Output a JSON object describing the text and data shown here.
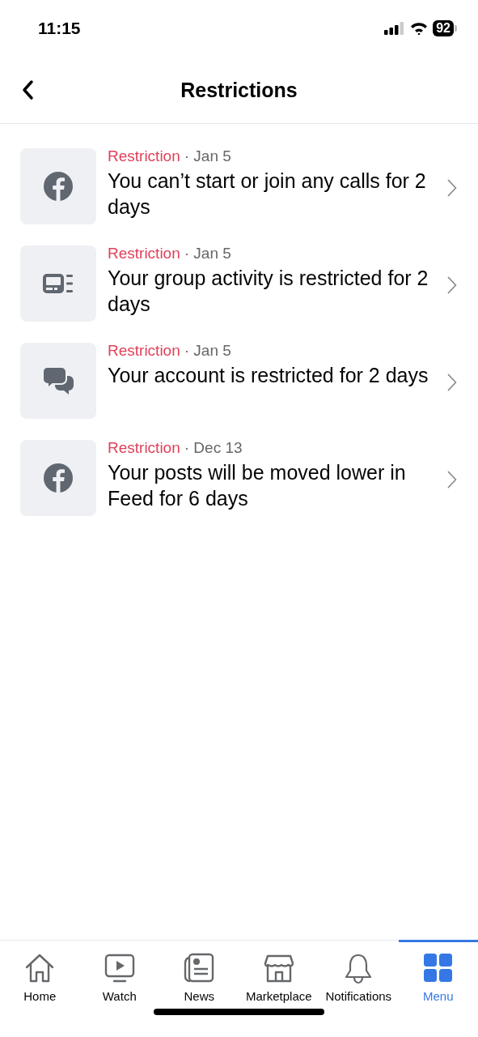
{
  "status_bar": {
    "time": "11:15",
    "battery": "92"
  },
  "header": {
    "title": "Restrictions"
  },
  "items": [
    {
      "category": "Restriction",
      "date": "· Jan 5",
      "text": "You can’t start or join any calls for 2 days"
    },
    {
      "category": "Restriction",
      "date": "· Jan 5",
      "text": "Your group activity is restricted for 2 days"
    },
    {
      "category": "Restriction",
      "date": "· Jan 5",
      "text": "Your account is restricted for 2 days"
    },
    {
      "category": "Restriction",
      "date": "· Dec 13",
      "text": "Your posts will be moved lower in Feed for 6 days"
    }
  ],
  "tabs": [
    {
      "label": "Home",
      "selected": false
    },
    {
      "label": "Watch",
      "selected": false
    },
    {
      "label": "News",
      "selected": false
    },
    {
      "label": "Marketplace",
      "selected": false
    },
    {
      "label": "Notifications",
      "selected": false
    },
    {
      "label": "Menu",
      "selected": true
    }
  ]
}
